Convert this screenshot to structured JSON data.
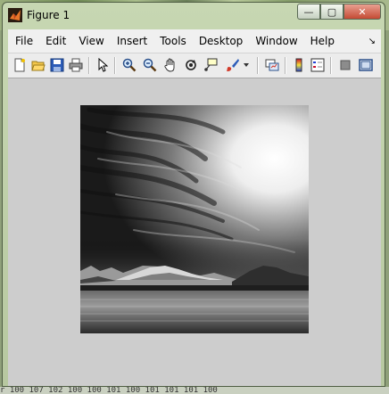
{
  "window": {
    "title": "Figure 1"
  },
  "window_controls": {
    "minimize": "—",
    "maximize": "▢",
    "close": "✕"
  },
  "menu": {
    "items": [
      "File",
      "Edit",
      "View",
      "Insert",
      "Tools",
      "Desktop",
      "Window",
      "Help"
    ],
    "dock_glyph": "↘"
  },
  "toolbar": {
    "buttons": [
      "new-figure",
      "open-file",
      "save-figure",
      "print-figure",
      "edit-plot",
      "zoom-in",
      "zoom-out",
      "pan",
      "rotate-3d",
      "data-cursor",
      "brush",
      "brush-menu",
      "link-plot",
      "insert-colorbar",
      "insert-legend",
      "hide-plot-tools",
      "show-plot-tools"
    ]
  },
  "figure": {
    "image_description_icon": "grayscale-landscape-image"
  },
  "background_strip_text": "r 100  107  102  100  100  101  100  101  101  101  100"
}
